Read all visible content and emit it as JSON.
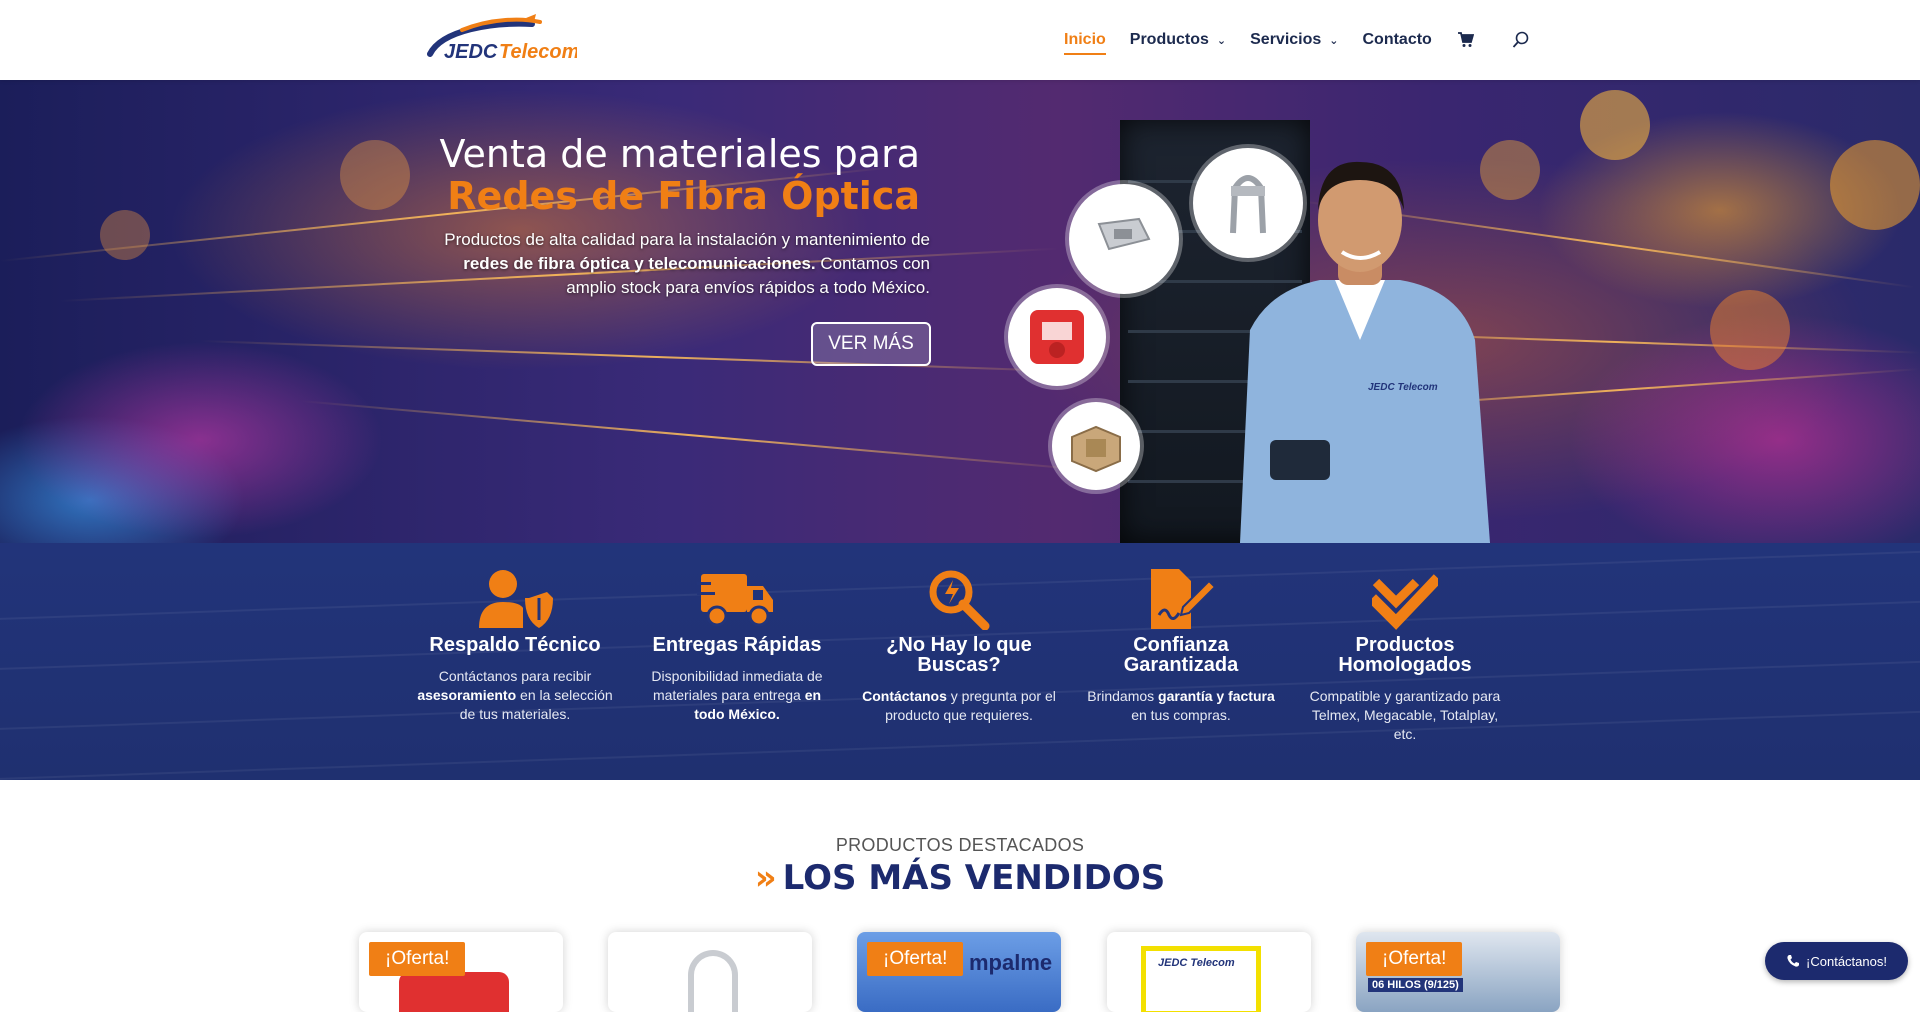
{
  "brand": {
    "name": "JEDC Telecom",
    "colors": {
      "accent": "#f07f15",
      "navy": "#1c2a6e"
    }
  },
  "nav": {
    "items": [
      {
        "label": "Inicio",
        "active": true
      },
      {
        "label": "Productos",
        "dropdown": true
      },
      {
        "label": "Servicios",
        "dropdown": true
      },
      {
        "label": "Contacto"
      }
    ],
    "cart_icon": "cart-icon",
    "search_icon": "search-icon"
  },
  "hero": {
    "title_line1": "Venta de materiales para",
    "title_line2": "Redes de Fibra Óptica",
    "desc_part1": "Productos de alta calidad para la instalación y mantenimiento de",
    "desc_bold": "redes de fibra óptica y telecomunicaciones.",
    "desc_part2": "Contamos con amplio stock para envíos rápidos a todo México.",
    "button_label": "VER MÁS",
    "person_logo": "JEDC Telecom"
  },
  "features": [
    {
      "icon": "user-shield-icon",
      "title": "Respaldo Técnico",
      "desc_a": "Contáctanos para recibir",
      "desc_b": "asesoramiento",
      "desc_c": "en la selección de tus materiales."
    },
    {
      "icon": "truck-icon",
      "title": "Entregas Rápidas",
      "desc_a": "Disponibilidad inmediata de materiales para entrega",
      "desc_b": "en todo México.",
      "desc_c": ""
    },
    {
      "icon": "search-bolt-icon",
      "title": "¿No Hay lo que Buscas?",
      "desc_a": "",
      "desc_b": "Contáctanos",
      "desc_c": "y pregunta por el producto que requieres."
    },
    {
      "icon": "signed-document-icon",
      "title": "Confianza Garantizada",
      "desc_a": "Brindamos",
      "desc_b": "garantía y factura",
      "desc_c": "en tus compras."
    },
    {
      "icon": "double-check-icon",
      "title": "Productos Homologados",
      "desc_a": "Compatible y garantizado para Telmex, Megacable, Totalplay, etc.",
      "desc_b": "",
      "desc_c": ""
    }
  ],
  "products_section": {
    "subtitle": "PRODUCTOS DESTACADOS",
    "title": "LOS MÁS VENDIDOS",
    "cards": [
      {
        "badge": "¡Oferta!"
      },
      {
        "badge": ""
      },
      {
        "badge": "¡Oferta!",
        "image_text": "mpalme"
      },
      {
        "badge": "",
        "image_text": "JEDC Telecom"
      },
      {
        "badge": "¡Oferta!",
        "image_text": "06 HILOS (9/125)"
      }
    ]
  },
  "chat": {
    "label": "¡Contáctanos!",
    "icon": "phone-icon"
  }
}
